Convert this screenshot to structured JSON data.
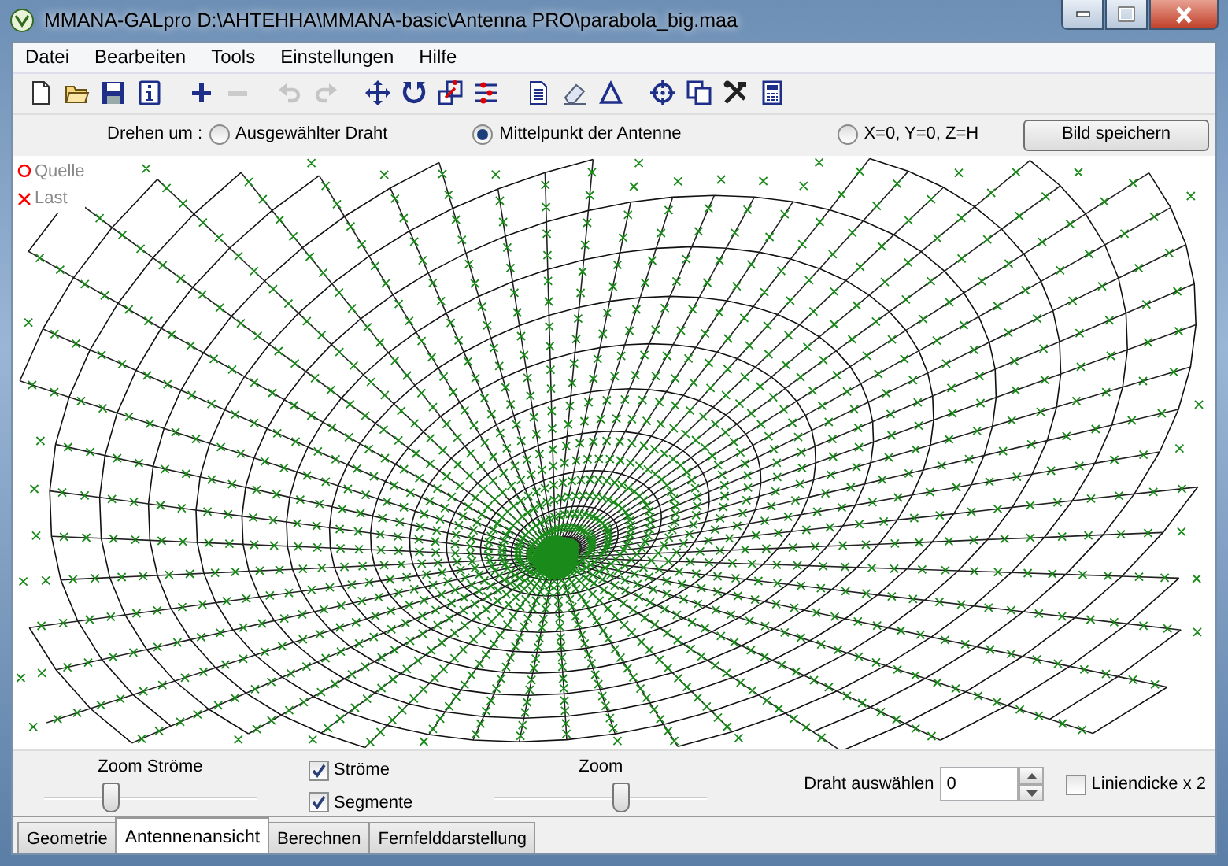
{
  "window": {
    "title": "MMANA-GALpro D:\\AHTEHHA\\MMANA-basic\\Antenna PRO\\parabola_big.maa"
  },
  "menu": [
    "Datei",
    "Bearbeiten",
    "Tools",
    "Einstellungen",
    "Hilfe"
  ],
  "toolbar": [
    {
      "kind": "new",
      "disabled": false
    },
    {
      "kind": "open",
      "disabled": false
    },
    {
      "kind": "save",
      "disabled": false
    },
    {
      "kind": "info",
      "disabled": false
    },
    {
      "kind": "sep"
    },
    {
      "kind": "plus",
      "disabled": false
    },
    {
      "kind": "minus",
      "disabled": true
    },
    {
      "kind": "sep"
    },
    {
      "kind": "undo",
      "disabled": true
    },
    {
      "kind": "redo",
      "disabled": true
    },
    {
      "kind": "sep"
    },
    {
      "kind": "move",
      "disabled": false
    },
    {
      "kind": "rotate",
      "disabled": false
    },
    {
      "kind": "scale",
      "disabled": false
    },
    {
      "kind": "lines",
      "disabled": false
    },
    {
      "kind": "sep"
    },
    {
      "kind": "doc",
      "disabled": false
    },
    {
      "kind": "eraser",
      "disabled": false
    },
    {
      "kind": "triangle",
      "disabled": false
    },
    {
      "kind": "sep"
    },
    {
      "kind": "target",
      "disabled": false
    },
    {
      "kind": "copy",
      "disabled": false
    },
    {
      "kind": "tools",
      "disabled": false
    },
    {
      "kind": "calc",
      "disabled": false
    }
  ],
  "rotate": {
    "label": "Drehen um :",
    "options": [
      {
        "label": "Ausgewählter Draht",
        "selected": false
      },
      {
        "label": "Mittelpunkt der Antenne",
        "selected": true
      },
      {
        "label": "X=0, Y=0, Z=H",
        "selected": false
      }
    ],
    "button": "Bild speichern"
  },
  "legend": [
    {
      "kind": "circle",
      "label": "Quelle",
      "color": "#ff0000"
    },
    {
      "kind": "cross",
      "label": "Last",
      "color": "#ff0000"
    }
  ],
  "controls": {
    "zoom_currents": {
      "label": "Zoom Ströme",
      "level": 0.3
    },
    "checkboxes": [
      {
        "label": "Ströme",
        "checked": true
      },
      {
        "label": "Segmente",
        "checked": true
      }
    ],
    "zoom": {
      "label": "Zoom",
      "level": 0.6
    },
    "wire_select": {
      "label": "Draht auswählen",
      "value": "0"
    },
    "line_width": {
      "label": "Liniendicke x 2",
      "checked": false
    }
  },
  "tabs": [
    {
      "label": "Geometrie",
      "selected": false
    },
    {
      "label": "Antennenansicht",
      "selected": true
    },
    {
      "label": "Berechnen",
      "selected": false
    },
    {
      "label": "Fernfelddarstellung",
      "selected": false
    }
  ]
}
